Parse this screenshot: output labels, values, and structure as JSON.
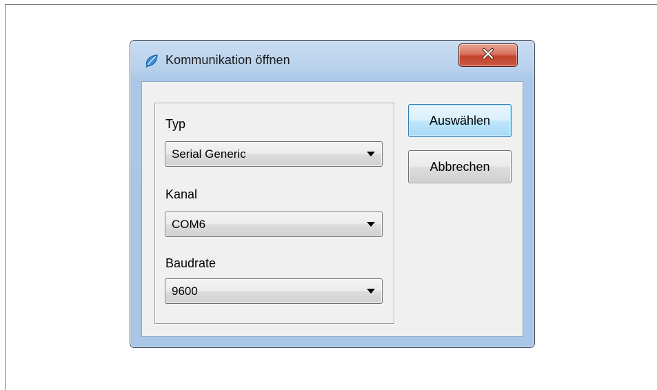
{
  "window": {
    "title": "Kommunikation öffnen",
    "icon": "app-leaf-icon",
    "close_icon": "close-icon"
  },
  "fields": {
    "typ": {
      "label": "Typ",
      "value": "Serial Generic"
    },
    "kanal": {
      "label": "Kanal",
      "value": "COM6"
    },
    "baudrate": {
      "label": "Baudrate",
      "value": "9600"
    }
  },
  "buttons": {
    "select_label": "Auswählen",
    "cancel_label": "Abbrechen"
  },
  "colors": {
    "close_button": "#c4422a",
    "default_button_border": "#3c7fb1",
    "dialog_background": "#f0f0f0"
  }
}
